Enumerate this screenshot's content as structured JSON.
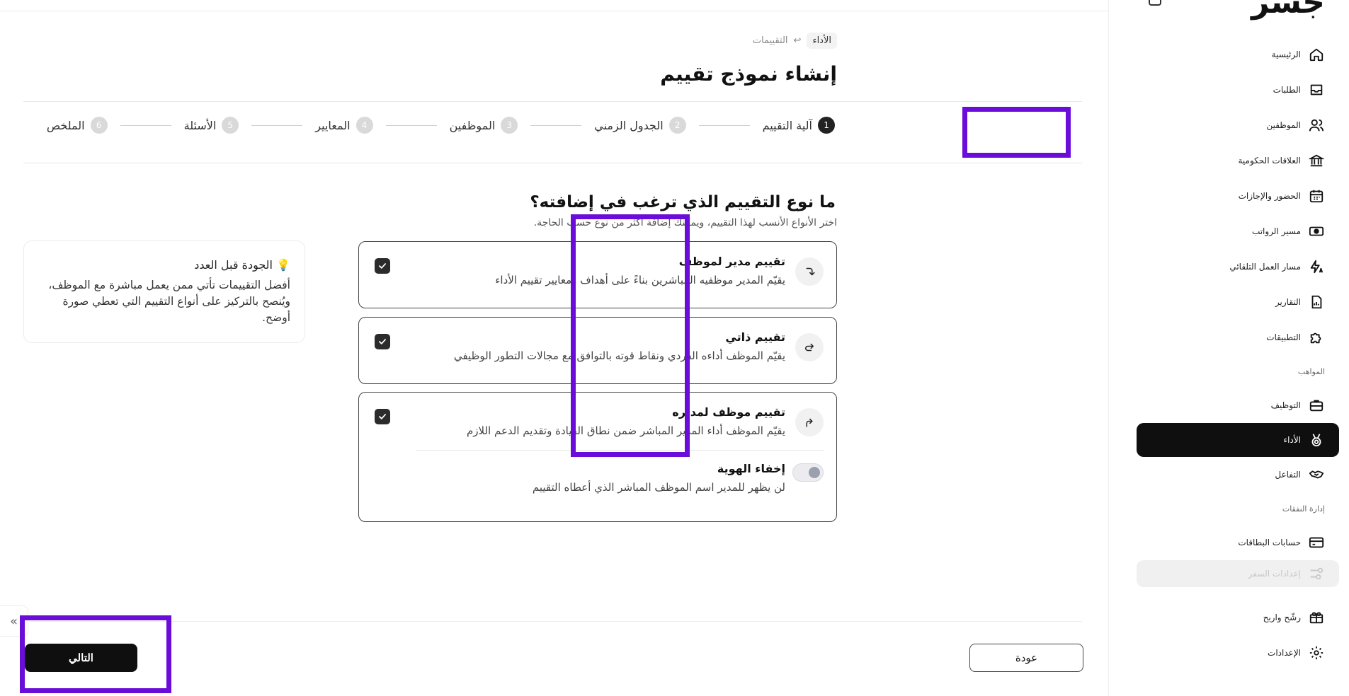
{
  "breadcrumb": {
    "current": "الأداء",
    "separator": "↩",
    "link": "التقييمات"
  },
  "page_title": "إنشاء نموذج تقييم",
  "steps": [
    {
      "num": "1",
      "label": "آلية التقييم",
      "active": true
    },
    {
      "num": "2",
      "label": "الجدول الزمني"
    },
    {
      "num": "3",
      "label": "الموظفين"
    },
    {
      "num": "4",
      "label": "المعايير"
    },
    {
      "num": "5",
      "label": "الأسئلة"
    },
    {
      "num": "6",
      "label": "الملخص"
    }
  ],
  "question": {
    "title": "ما نوع التقييم الذي ترغب في إضافته؟",
    "subtitle": "اختر الأنواع الأنسب لهذا التقييم، ويمكنك إضافة أكثر من نوع حسب الحاجة."
  },
  "types": [
    {
      "title": "تقييم مدير لموظف",
      "desc": "يقيّم المدير موظفيه المباشرين بناءً على أهداف ومعايير تقييم الأداء",
      "checked": true,
      "icon": "arrow-down-turn-icon"
    },
    {
      "title": "تقييم ذاتي",
      "desc": "يقيّم الموظف أداءه الفردي ونقاط قوته بالتوافق مع مجالات التطور الوظيفي",
      "checked": true,
      "icon": "self-loop-icon"
    },
    {
      "title": "تقييم موظف لمديره",
      "desc": "يقيّم الموظف أداء المدير المباشر ضمن نطاق القيادة وتقديم الدعم اللازم",
      "checked": true,
      "icon": "arrow-up-turn-icon"
    }
  ],
  "anonymity": {
    "title": "إخفاء الهوية",
    "desc": "لن يظهر للمدير اسم الموظف المباشر الذي أعطاه التقييم",
    "enabled": false
  },
  "tip": {
    "icon": "💡",
    "title": "الجودة قبل العدد",
    "body": "أفضل التقييمات تأتي ممن يعمل مباشرة مع الموظف، ويُنصح بالتركيز على أنواع التقييم التي تعطي صورة أوضح."
  },
  "buttons": {
    "next": "التالي",
    "back": "عودة"
  },
  "collapse_glyph": "»",
  "sidebar": {
    "logo": "جسر",
    "items": [
      {
        "label": "الرئيسية",
        "icon": "home-icon"
      },
      {
        "label": "الطلبات",
        "icon": "inbox-icon"
      },
      {
        "label": "الموظفين",
        "icon": "users-icon"
      },
      {
        "label": "العلاقات الحكومية",
        "icon": "bank-icon"
      },
      {
        "label": "الحضور والإجازات",
        "icon": "calendar-icon"
      },
      {
        "label": "مسير الرواتب",
        "icon": "cash-icon"
      },
      {
        "label": "مسار العمل التلقائي",
        "icon": "automation-icon"
      },
      {
        "label": "التقارير",
        "icon": "report-icon"
      },
      {
        "label": "التطبيقات",
        "icon": "puzzle-icon"
      }
    ],
    "section_talent": "المواهب",
    "talent_items": [
      {
        "label": "التوظيف",
        "icon": "briefcase-icon"
      },
      {
        "label": "الأداء",
        "icon": "medal-icon",
        "active": true
      },
      {
        "label": "التفاعل",
        "icon": "handshake-icon"
      }
    ],
    "section_expenses": "إدارة النفقات",
    "expense_items": [
      {
        "label": "حسابات البطاقات",
        "icon": "card-icon"
      },
      {
        "label": "إعدادات السفر",
        "icon": "travel-settings-icon",
        "disabled": true
      }
    ],
    "bottom_items": [
      {
        "label": "رشّح واربح",
        "icon": "gift-icon"
      },
      {
        "label": "الإعدادات",
        "icon": "gear-icon"
      }
    ]
  },
  "colors": {
    "highlight": "#6a0dd8",
    "primary": "#0f0f10"
  }
}
